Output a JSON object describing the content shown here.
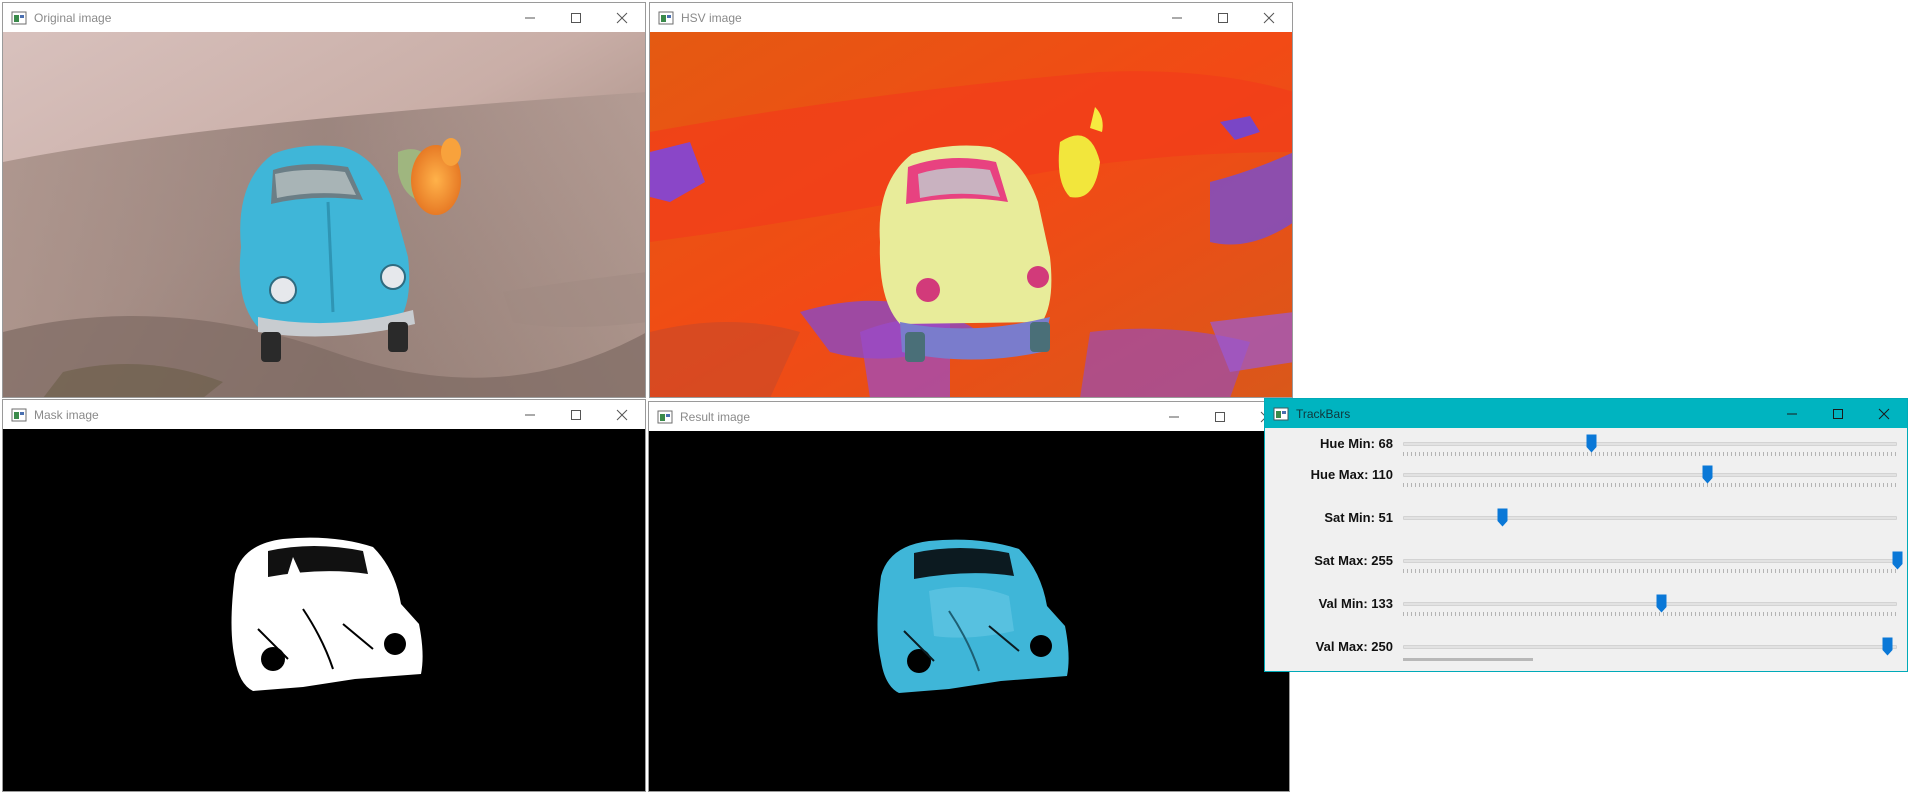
{
  "windows": {
    "original": {
      "title": "Original image"
    },
    "hsv": {
      "title": "HSV image"
    },
    "mask": {
      "title": "Mask image"
    },
    "result": {
      "title": "Result image"
    },
    "trackbars": {
      "title": "TrackBars",
      "sliders": [
        {
          "label": "Hue Min: 68",
          "value": 68,
          "max": 179
        },
        {
          "label": "Hue Max: 110",
          "value": 110,
          "max": 179
        },
        {
          "label": "Sat Min: 51",
          "value": 51,
          "max": 255
        },
        {
          "label": "Sat Max: 255",
          "value": 255,
          "max": 255
        },
        {
          "label": "Val Min: 133",
          "value": 133,
          "max": 255
        },
        {
          "label": "Val Max: 250",
          "value": 250,
          "max": 255
        }
      ]
    }
  },
  "icons": {
    "app": "app-window-icon",
    "minimize": "minimize-icon",
    "maximize": "maximize-icon",
    "close": "close-icon",
    "thumb": "slider-thumb-icon"
  },
  "colors": {
    "accent_titlebar": "#00b4c0",
    "thumb": "#0a78d7",
    "car_blue": "#3fb6d8"
  }
}
